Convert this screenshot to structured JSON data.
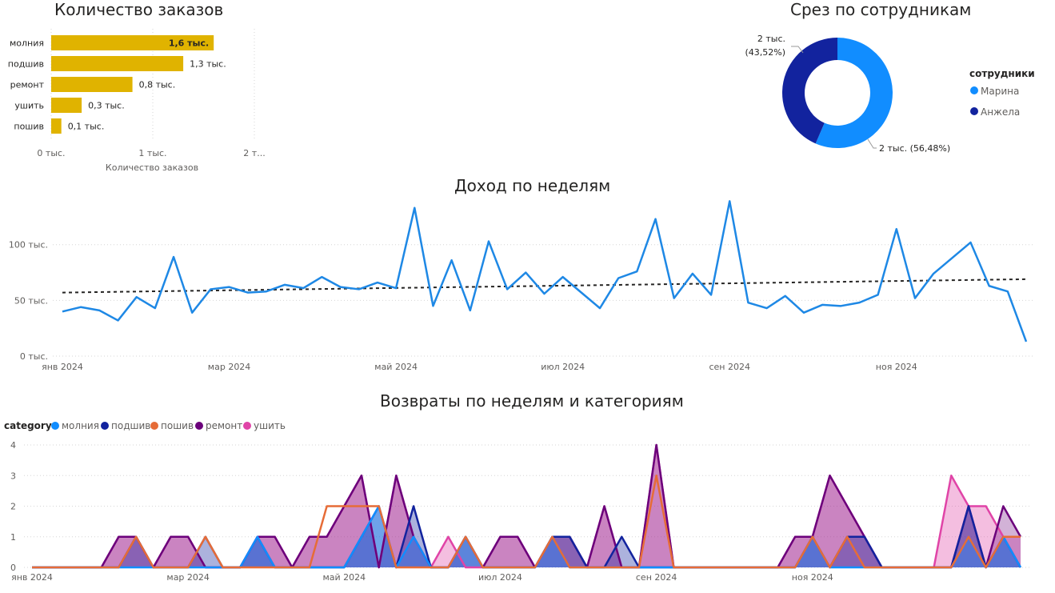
{
  "colors": {
    "bar": "#e0b300",
    "marina": "#118dff",
    "anzhela": "#12239e",
    "revenue_line": "#1e88e5",
    "trend": "#252423",
    "molniya": "#118dff",
    "podshiv": "#12239e",
    "poshiv": "#e66c37",
    "remont": "#6b007b",
    "ushit": "#e044a7"
  },
  "chart_data": [
    {
      "id": "orders",
      "type": "bar",
      "orientation": "horizontal",
      "title": "Количество заказов",
      "xlabel": "Количество заказов",
      "categories": [
        "молния",
        "подшив",
        "ремонт",
        "ушить",
        "пошив"
      ],
      "values": [
        1.6,
        1.3,
        0.8,
        0.3,
        0.1
      ],
      "data_labels": [
        "1,6 тыс.",
        "1,3 тыс.",
        "0,8 тыс.",
        "0,3 тыс.",
        "0,1 тыс."
      ],
      "xlim": [
        0,
        2
      ],
      "xticks": [
        {
          "value": 0,
          "label": "0 тыс."
        },
        {
          "value": 1,
          "label": "1 тыс."
        },
        {
          "value": 2,
          "label": "2 т..."
        }
      ],
      "grid": true
    },
    {
      "id": "staff",
      "type": "pie",
      "donut": true,
      "title": "Срез по сотрудникам",
      "legend_title": "сотрудники",
      "legend_position": "right",
      "slices": [
        {
          "name": "Марина",
          "value": 56.48,
          "label": "2 тыс. (56,48%)"
        },
        {
          "name": "Анжела",
          "value": 43.52,
          "label": "2 тыс.\n(43,52%)"
        }
      ]
    },
    {
      "id": "revenue",
      "type": "line",
      "title": "Доход по неделям",
      "ylim": [
        0,
        140
      ],
      "yticks": [
        {
          "value": 0,
          "label": "0 тыс."
        },
        {
          "value": 50,
          "label": "50 тыс."
        },
        {
          "value": 100,
          "label": "100 тыс."
        }
      ],
      "xticks": [
        {
          "week": 0,
          "label": "янв 2024"
        },
        {
          "week": 9,
          "label": "мар 2024"
        },
        {
          "week": 18,
          "label": "май 2024"
        },
        {
          "week": 27,
          "label": "июл 2024"
        },
        {
          "week": 36,
          "label": "сен 2024"
        },
        {
          "week": 45,
          "label": "ноя 2024"
        }
      ],
      "grid": true,
      "values": [
        40,
        44,
        41,
        32,
        53,
        43,
        89,
        39,
        60,
        62,
        57,
        58,
        64,
        61,
        71,
        62,
        60,
        66,
        61,
        133,
        45,
        86,
        41,
        103,
        60,
        75,
        56,
        71,
        57,
        43,
        70,
        76,
        123,
        52,
        74,
        55,
        139,
        48,
        43,
        54,
        39,
        46,
        45,
        48,
        55,
        114,
        52,
        74,
        88,
        102,
        63,
        58,
        13
      ],
      "trend": {
        "start": 57,
        "end": 69,
        "style": "dashed"
      }
    },
    {
      "id": "returns",
      "type": "area",
      "title": "Возвраты по неделям и категориям",
      "legend_title": "category",
      "legend_position": "top-left",
      "ylim": [
        0,
        4
      ],
      "yticks": [
        0,
        1,
        2,
        3,
        4
      ],
      "xticks": [
        {
          "week": 0,
          "label": "янв 2024"
        },
        {
          "week": 9,
          "label": "мар 2024"
        },
        {
          "week": 18,
          "label": "май 2024"
        },
        {
          "week": 27,
          "label": "июл 2024"
        },
        {
          "week": 36,
          "label": "сен 2024"
        },
        {
          "week": 45,
          "label": "ноя 2024"
        }
      ],
      "grid": true,
      "series": [
        {
          "name": "молния",
          "key": "molniya",
          "values": [
            0,
            0,
            0,
            0,
            0,
            0,
            0,
            0,
            0,
            0,
            0,
            0,
            0,
            1,
            0,
            0,
            0,
            0,
            0,
            1,
            2,
            0,
            1,
            0,
            0,
            1,
            0,
            0,
            0,
            0,
            1,
            0,
            0,
            0,
            0,
            0,
            0,
            0,
            0,
            0,
            0,
            0,
            0,
            0,
            0,
            1,
            0,
            0,
            0,
            0,
            0,
            0,
            0,
            0,
            1,
            0,
            1,
            0
          ]
        },
        {
          "name": "подшив",
          "key": "podshiv",
          "values": [
            0,
            0,
            0,
            0,
            0,
            0,
            1,
            0,
            0,
            0,
            1,
            0,
            0,
            1,
            0,
            0,
            0,
            0,
            0,
            1,
            2,
            0,
            2,
            0,
            0,
            1,
            0,
            0,
            0,
            0,
            1,
            1,
            0,
            0,
            1,
            0,
            0,
            0,
            0,
            0,
            0,
            0,
            0,
            0,
            0,
            1,
            0,
            1,
            1,
            0,
            0,
            0,
            0,
            0,
            2,
            0,
            1,
            0
          ]
        },
        {
          "name": "пошив",
          "key": "poshiv",
          "values": [
            0,
            0,
            0,
            0,
            0,
            0,
            1,
            0,
            0,
            0,
            1,
            0,
            0,
            0,
            0,
            0,
            0,
            2,
            2,
            2,
            2,
            0,
            0,
            0,
            0,
            1,
            0,
            0,
            0,
            0,
            1,
            0,
            0,
            0,
            0,
            0,
            3,
            0,
            0,
            0,
            0,
            0,
            0,
            0,
            0,
            1,
            0,
            1,
            0,
            0,
            0,
            0,
            0,
            0,
            1,
            0,
            1,
            1
          ]
        },
        {
          "name": "ремонт",
          "key": "remont",
          "values": [
            0,
            0,
            0,
            0,
            0,
            1,
            1,
            0,
            1,
            1,
            0,
            0,
            0,
            1,
            1,
            0,
            1,
            1,
            2,
            3,
            0,
            3,
            1,
            0,
            0,
            1,
            0,
            1,
            1,
            0,
            1,
            1,
            0,
            2,
            0,
            0,
            4,
            0,
            0,
            0,
            0,
            0,
            0,
            0,
            1,
            1,
            3,
            2,
            1,
            0,
            0,
            0,
            0,
            0,
            2,
            0,
            2,
            1
          ]
        },
        {
          "name": "ушить",
          "key": "ushit",
          "values": [
            0,
            0,
            0,
            0,
            0,
            1,
            1,
            0,
            1,
            1,
            0,
            0,
            0,
            1,
            1,
            0,
            1,
            1,
            2,
            3,
            0,
            3,
            1,
            0,
            1,
            0,
            0,
            1,
            1,
            0,
            1,
            1,
            0,
            2,
            0,
            0,
            4,
            0,
            0,
            0,
            0,
            0,
            0,
            0,
            1,
            1,
            3,
            2,
            1,
            0,
            0,
            0,
            0,
            3,
            2,
            2,
            1,
            1
          ]
        }
      ]
    }
  ]
}
